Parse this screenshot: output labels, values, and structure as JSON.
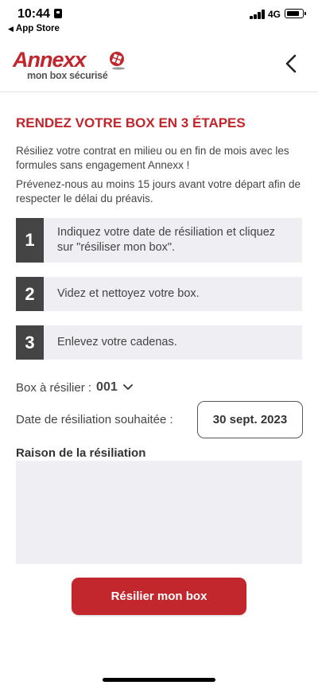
{
  "status_bar": {
    "time": "10:44",
    "back_app": "App Store",
    "network": "4G"
  },
  "header": {
    "logo_name": "Annexx",
    "logo_tagline": "mon box sécurisé",
    "back_icon": "chevron-left-icon"
  },
  "content": {
    "title": "RENDEZ VOTRE BOX EN 3 ÉTAPES",
    "intro_1": "Résiliez votre contrat en milieu ou en fin de mois avec les formules sans engagement Annexx !",
    "intro_2": "Prévenez-nous au moins 15 jours avant votre départ afin de respecter le délai du préavis.",
    "steps": [
      {
        "number": "1",
        "text": "Indiquez votre date de résiliation et cliquez sur \"résiliser mon box\"."
      },
      {
        "number": "2",
        "text": "Videz et nettoyez votre box."
      },
      {
        "number": "3",
        "text": "Enlevez votre cadenas."
      }
    ],
    "box_label": "Box à résilier :",
    "box_value": "001",
    "date_label": "Date de résiliation souhaitée :",
    "date_value": "30 sept. 2023",
    "reason_label": "Raison de la résiliation",
    "reason_value": "",
    "submit_label": "Résilier mon box"
  },
  "colors": {
    "brand_red": "#c0262c",
    "step_number_bg": "#444444",
    "panel_bg": "#eeeef3"
  }
}
